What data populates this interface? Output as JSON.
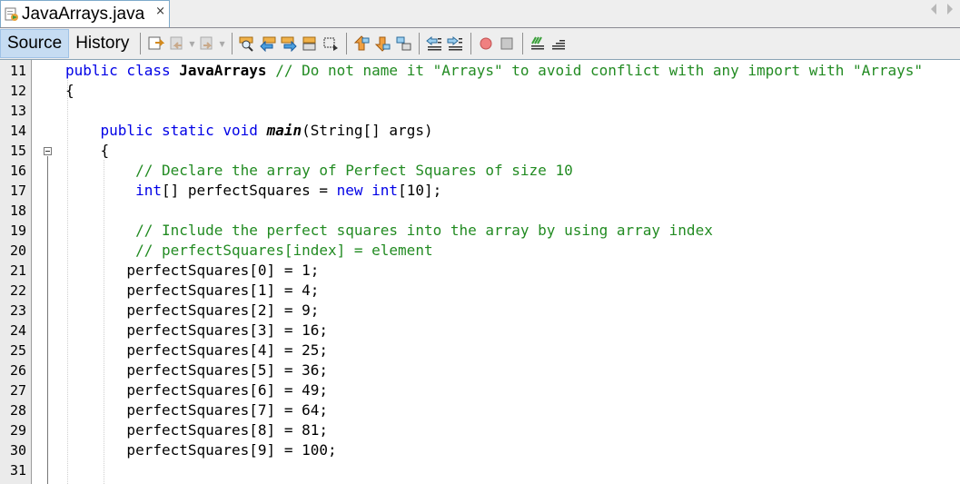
{
  "tab": {
    "filename": "JavaArrays.java",
    "close_glyph": "×",
    "icon": "java-file-icon"
  },
  "toolbar": {
    "source_label": "Source",
    "history_label": "History",
    "icons": [
      "last-edit-icon",
      "back-icon",
      "forward-icon",
      "find-icon",
      "find-previous-icon",
      "find-next-icon",
      "toggle-highlight-icon",
      "toggle-rect-select-icon",
      "previous-bookmark-icon",
      "next-bookmark-icon",
      "toggle-bookmark-icon",
      "shift-left-icon",
      "shift-right-icon",
      "start-macro-record-icon",
      "stop-macro-record-icon",
      "comment-icon",
      "uncomment-icon"
    ]
  },
  "editor": {
    "lines": [
      {
        "num": "11",
        "segments": [
          {
            "t": "public class ",
            "c": "kw"
          },
          {
            "t": "JavaArrays",
            "c": "bold"
          },
          {
            "t": " // Do not name it \"Arrays\" to avoid conflict with any import with \"Arrays\"",
            "c": "cm"
          }
        ]
      },
      {
        "num": "12",
        "segments": [
          {
            "t": "{",
            "c": ""
          }
        ]
      },
      {
        "num": "13",
        "segments": []
      },
      {
        "num": "14",
        "segments": [
          {
            "t": "    public static void ",
            "c": "kw"
          },
          {
            "t": "main",
            "c": "bi"
          },
          {
            "t": "(String[] args)",
            "c": ""
          }
        ]
      },
      {
        "num": "15",
        "segments": [
          {
            "t": "    {",
            "c": ""
          }
        ]
      },
      {
        "num": "16",
        "segments": [
          {
            "t": "        // Declare the array of Perfect Squares of size 10",
            "c": "cm"
          }
        ]
      },
      {
        "num": "17",
        "segments": [
          {
            "t": "        int",
            "c": "kw"
          },
          {
            "t": "[] perfectSquares = ",
            "c": ""
          },
          {
            "t": "new int",
            "c": "kw"
          },
          {
            "t": "[10];",
            "c": ""
          }
        ]
      },
      {
        "num": "18",
        "segments": []
      },
      {
        "num": "19",
        "segments": [
          {
            "t": "        // Include the perfect squares into the array by using array index",
            "c": "cm"
          }
        ]
      },
      {
        "num": "20",
        "segments": [
          {
            "t": "        // perfectSquares[index] = element",
            "c": "cm"
          }
        ]
      },
      {
        "num": "21",
        "segments": [
          {
            "t": "       perfectSquares[0] = 1;",
            "c": ""
          }
        ]
      },
      {
        "num": "22",
        "segments": [
          {
            "t": "       perfectSquares[1] = 4;",
            "c": ""
          }
        ]
      },
      {
        "num": "23",
        "segments": [
          {
            "t": "       perfectSquares[2] = 9;",
            "c": ""
          }
        ]
      },
      {
        "num": "24",
        "segments": [
          {
            "t": "       perfectSquares[3] = 16;",
            "c": ""
          }
        ]
      },
      {
        "num": "25",
        "segments": [
          {
            "t": "       perfectSquares[4] = 25;",
            "c": ""
          }
        ]
      },
      {
        "num": "26",
        "segments": [
          {
            "t": "       perfectSquares[5] = 36;",
            "c": ""
          }
        ]
      },
      {
        "num": "27",
        "segments": [
          {
            "t": "       perfectSquares[6] = 49;",
            "c": ""
          }
        ]
      },
      {
        "num": "28",
        "segments": [
          {
            "t": "       perfectSquares[7] = 64;",
            "c": ""
          }
        ]
      },
      {
        "num": "29",
        "segments": [
          {
            "t": "       perfectSquares[8] = 81;",
            "c": ""
          }
        ]
      },
      {
        "num": "30",
        "segments": [
          {
            "t": "       perfectSquares[9] = 100;",
            "c": ""
          }
        ]
      },
      {
        "num": "31",
        "segments": []
      }
    ]
  }
}
